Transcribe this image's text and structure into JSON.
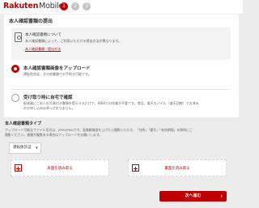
{
  "header": {
    "brand": "Rakuten",
    "product": "Mobile",
    "steps": [
      "1",
      "2",
      "3"
    ]
  },
  "card": {
    "title": "本人確認書類の提出",
    "notice": {
      "title": "本人確認書類について",
      "body": "本人確認書類によって、ご利用いただける提出方法が異なります。",
      "link": "本人確認書類・提出方法"
    },
    "option1": {
      "title": "本人確認書類画像をアップロード",
      "desc": "運転免許証、その他書類でお手続き可能です。"
    },
    "option2": {
      "title": "受け取り時に自宅で確認",
      "desc_line1": "配達員にご本人の写真付き書類を提示するだけで、WEBでの作業が不要です。商品、楽天モバイル（楽天回線）でお済み",
      "desc_line2": "のお申し込みは承っておりません。"
    }
  },
  "upload_section": {
    "title": "本人確認書類タイプ",
    "note_line1": "アップロード可能なファイル形式は、JPEG/PNGです。画像解像度を上げたら撮影いただき、「住所」「番号」「有効期限」を鮮明にご",
    "note_line2": "撮影ください。書類が複数ある場合はアップロードをお願いします。",
    "select_value": "運転免許証",
    "front_label": "表面を読み取る",
    "back_label": "裏面を読み取る"
  },
  "footer": {
    "next_label": "次へ進む",
    "next_icon": "›"
  },
  "colors": {
    "accent": "#bf0000",
    "background": "#ececec"
  }
}
